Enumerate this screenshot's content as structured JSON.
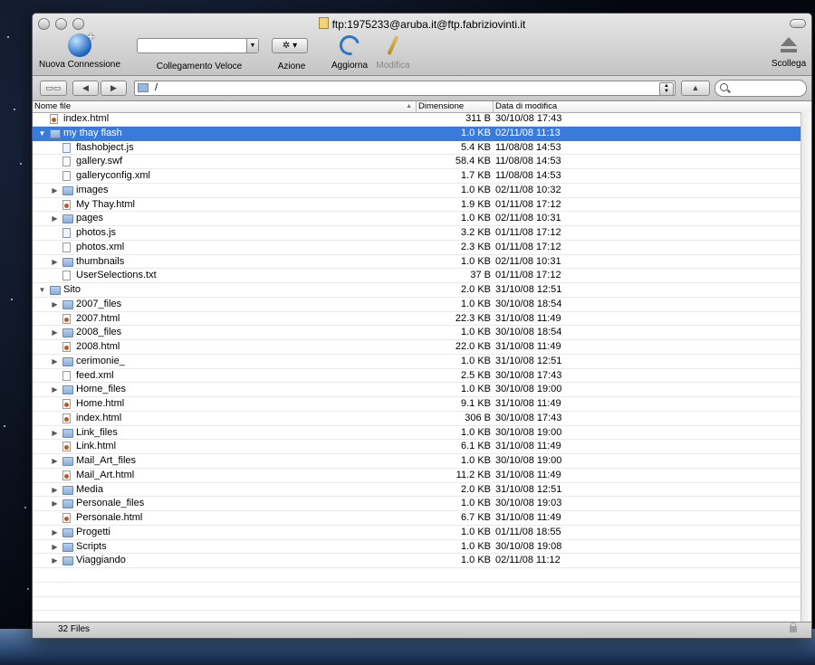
{
  "window": {
    "title": "ftp:1975233@aruba.it@ftp.fabriziovinti.it"
  },
  "toolbar": {
    "new_connection": "Nuova Connessione",
    "quick_connect": "Collegamento Veloce",
    "action": "Azione",
    "refresh": "Aggiorna",
    "edit": "Modifica",
    "disconnect": "Scollega",
    "action_glyph": "✲ ▾"
  },
  "pathbar": {
    "path": "/",
    "back": "◀",
    "forward": "▶",
    "up": "▲"
  },
  "columns": {
    "name": "Nome file",
    "size": "Dimensione",
    "date": "Data di modifica",
    "sort": "▲"
  },
  "rows": [
    {
      "name": "index.html",
      "size": "311 B",
      "date": "30/10/08 17:43",
      "type": "html",
      "depth": 0,
      "tri": ""
    },
    {
      "name": "my thay flash",
      "size": "1.0 KB",
      "date": "02/11/08 11:13",
      "type": "folder",
      "depth": 0,
      "tri": "▼",
      "selected": true
    },
    {
      "name": "flashobject.js",
      "size": "5.4 KB",
      "date": "11/08/08 14:53",
      "type": "js",
      "depth": 1,
      "tri": ""
    },
    {
      "name": "gallery.swf",
      "size": "58.4 KB",
      "date": "11/08/08 14:53",
      "type": "doc",
      "depth": 1,
      "tri": ""
    },
    {
      "name": "galleryconfig.xml",
      "size": "1.7 KB",
      "date": "11/08/08 14:53",
      "type": "doc",
      "depth": 1,
      "tri": ""
    },
    {
      "name": "images",
      "size": "1.0 KB",
      "date": "02/11/08 10:32",
      "type": "folder",
      "depth": 1,
      "tri": "▶"
    },
    {
      "name": "My Thay.html",
      "size": "1.9 KB",
      "date": "01/11/08 17:12",
      "type": "html",
      "depth": 1,
      "tri": ""
    },
    {
      "name": "pages",
      "size": "1.0 KB",
      "date": "02/11/08 10:31",
      "type": "folder",
      "depth": 1,
      "tri": "▶"
    },
    {
      "name": "photos.js",
      "size": "3.2 KB",
      "date": "01/11/08 17:12",
      "type": "js",
      "depth": 1,
      "tri": ""
    },
    {
      "name": "photos.xml",
      "size": "2.3 KB",
      "date": "01/11/08 17:12",
      "type": "doc",
      "depth": 1,
      "tri": ""
    },
    {
      "name": "thumbnails",
      "size": "1.0 KB",
      "date": "02/11/08 10:31",
      "type": "folder",
      "depth": 1,
      "tri": "▶"
    },
    {
      "name": "UserSelections.txt",
      "size": "37 B",
      "date": "01/11/08 17:12",
      "type": "doc",
      "depth": 1,
      "tri": ""
    },
    {
      "name": "Sito",
      "size": "2.0 KB",
      "date": "31/10/08 12:51",
      "type": "folder",
      "depth": 0,
      "tri": "▼"
    },
    {
      "name": "2007_files",
      "size": "1.0 KB",
      "date": "30/10/08 18:54",
      "type": "folder",
      "depth": 1,
      "tri": "▶"
    },
    {
      "name": "2007.html",
      "size": "22.3 KB",
      "date": "31/10/08 11:49",
      "type": "html",
      "depth": 1,
      "tri": ""
    },
    {
      "name": "2008_files",
      "size": "1.0 KB",
      "date": "30/10/08 18:54",
      "type": "folder",
      "depth": 1,
      "tri": "▶"
    },
    {
      "name": "2008.html",
      "size": "22.0 KB",
      "date": "31/10/08 11:49",
      "type": "html",
      "depth": 1,
      "tri": ""
    },
    {
      "name": "cerimonie_",
      "size": "1.0 KB",
      "date": "31/10/08 12:51",
      "type": "folder",
      "depth": 1,
      "tri": "▶"
    },
    {
      "name": "feed.xml",
      "size": "2.5 KB",
      "date": "30/10/08 17:43",
      "type": "doc",
      "depth": 1,
      "tri": ""
    },
    {
      "name": "Home_files",
      "size": "1.0 KB",
      "date": "30/10/08 19:00",
      "type": "folder",
      "depth": 1,
      "tri": "▶"
    },
    {
      "name": "Home.html",
      "size": "9.1 KB",
      "date": "31/10/08 11:49",
      "type": "html",
      "depth": 1,
      "tri": ""
    },
    {
      "name": "index.html",
      "size": "306 B",
      "date": "30/10/08 17:43",
      "type": "html",
      "depth": 1,
      "tri": ""
    },
    {
      "name": "Link_files",
      "size": "1.0 KB",
      "date": "30/10/08 19:00",
      "type": "folder",
      "depth": 1,
      "tri": "▶"
    },
    {
      "name": "Link.html",
      "size": "6.1 KB",
      "date": "31/10/08 11:49",
      "type": "html",
      "depth": 1,
      "tri": ""
    },
    {
      "name": "Mail_Art_files",
      "size": "1.0 KB",
      "date": "30/10/08 19:00",
      "type": "folder",
      "depth": 1,
      "tri": "▶"
    },
    {
      "name": "Mail_Art.html",
      "size": "11.2 KB",
      "date": "31/10/08 11:49",
      "type": "html",
      "depth": 1,
      "tri": ""
    },
    {
      "name": "Media",
      "size": "2.0 KB",
      "date": "31/10/08 12:51",
      "type": "folder",
      "depth": 1,
      "tri": "▶"
    },
    {
      "name": "Personale_files",
      "size": "1.0 KB",
      "date": "30/10/08 19:03",
      "type": "folder",
      "depth": 1,
      "tri": "▶"
    },
    {
      "name": "Personale.html",
      "size": "6.7 KB",
      "date": "31/10/08 11:49",
      "type": "html",
      "depth": 1,
      "tri": ""
    },
    {
      "name": "Progetti",
      "size": "1.0 KB",
      "date": "01/11/08 18:55",
      "type": "folder",
      "depth": 1,
      "tri": "▶"
    },
    {
      "name": "Scripts",
      "size": "1.0 KB",
      "date": "30/10/08 19:08",
      "type": "folder",
      "depth": 1,
      "tri": "▶"
    },
    {
      "name": "Viaggiando",
      "size": "1.0 KB",
      "date": "02/11/08 11:12",
      "type": "folder",
      "depth": 1,
      "tri": "▶"
    }
  ],
  "status": {
    "count": "32 Files"
  },
  "colors": {
    "selection": "#3a7ad8",
    "accent": "#1f63c0"
  }
}
